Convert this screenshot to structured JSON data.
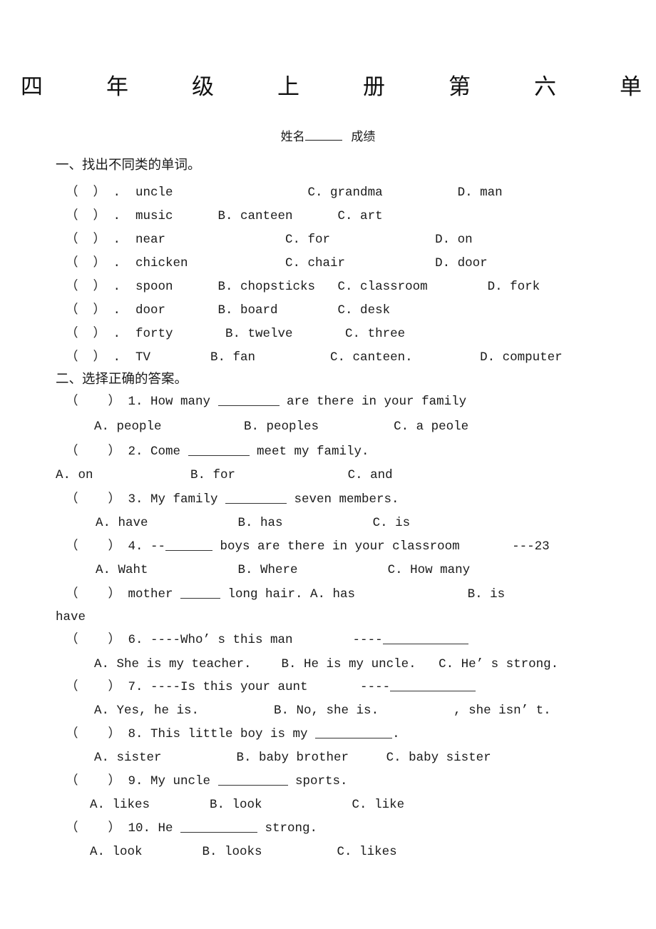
{
  "document": {
    "title": "四　年　级　上　册　第　六　单　元　测　试　卷",
    "name_label": "姓名",
    "score_label": "成绩"
  },
  "section1": {
    "heading": "一、找出不同类的单词。",
    "items": [
      {
        "marker": "（ ） .",
        "a": "uncle",
        "b": "",
        "c": "C. grandma",
        "d": "D. man"
      },
      {
        "marker": "（ ） .",
        "a": "music",
        "b": "B. canteen",
        "c": "C. art",
        "d": ""
      },
      {
        "marker": "（ ） .",
        "a": "near",
        "b": "",
        "c": "C. for",
        "d": "D. on"
      },
      {
        "marker": "（ ） .",
        "a": "chicken",
        "b": "",
        "c": "C. chair",
        "d": "D. door"
      },
      {
        "marker": "（ ） .",
        "a": "spoon",
        "b": "B. chopsticks",
        "c": "C. classroom",
        "d": "D. fork"
      },
      {
        "marker": "（ ） .",
        "a": "door",
        "b": "B. board",
        "c": "C. desk",
        "d": ""
      },
      {
        "marker": "（ ） .",
        "a": "forty",
        "b": "B. twelve",
        "c": "C. three",
        "d": ""
      },
      {
        "marker": "（ ） .",
        "a": "TV",
        "b": "B. fan",
        "c": "C. canteen.",
        "d": "D. computer"
      }
    ],
    "rendered_lines": [
      "（  ） .  uncle                  C. grandma          D. man",
      "（  ） .  music      B. canteen      C. art",
      "（  ） .  near                C. for              D. on",
      "（  ） .  chicken             C. chair            D. door",
      "（  ） .  spoon      B. chopsticks   C. classroom        D. fork",
      "（  ） .  door       B. board        C. desk",
      "（  ） .  forty       B. twelve       C. three",
      "（  ） .  TV        B. fan          C. canteen.         D. computer"
    ]
  },
  "section2": {
    "heading": "二、选择正确的答案。",
    "q1": {
      "stem_pre": "（    ） 1. How many ",
      "stem_post": " are there in your family",
      "options": "A. people           B. peoples          C. a peole"
    },
    "q2": {
      "stem_pre": "（    ） 2. Come ",
      "stem_post": " meet my family.",
      "options": "A. on             B. for               C. and"
    },
    "q3": {
      "stem_pre": "（    ） 3. My family ",
      "stem_post": " seven members.",
      "options": "A. have            B. has            C. is"
    },
    "q4": {
      "stem_pre": "（    ） 4. --",
      "stem_post": " boys are there in your classroom       ---23",
      "options": "A. Waht            B. Where            C. How many"
    },
    "q5": {
      "stem_pre": "（    ） mother ",
      "stem_post": " long hair. A. has               B. is                     C.",
      "wrap": "have"
    },
    "q6": {
      "stem_pre": "（    ） 6. ----Who’ s this man        ----",
      "options": "A. She is my teacher.    B. He is my uncle.   C. He’ s strong."
    },
    "q7": {
      "stem_pre": "（    ） 7. ----Is this your aunt       ----",
      "options": "A. Yes, he is.          B. No, she is.          , she isn’ t."
    },
    "q8": {
      "stem_pre": "（    ） 8. This little boy is my ",
      "stem_post": ".",
      "options": "A. sister          B. baby brother     C. baby sister"
    },
    "q9": {
      "stem_pre": "（    ） 9. My uncle ",
      "stem_post": " sports.",
      "options": "A. likes        B. look            C. like"
    },
    "q10": {
      "stem_pre": "（    ） 10. He ",
      "stem_post": " strong.",
      "options": "A. look        B. looks          C. likes"
    }
  }
}
